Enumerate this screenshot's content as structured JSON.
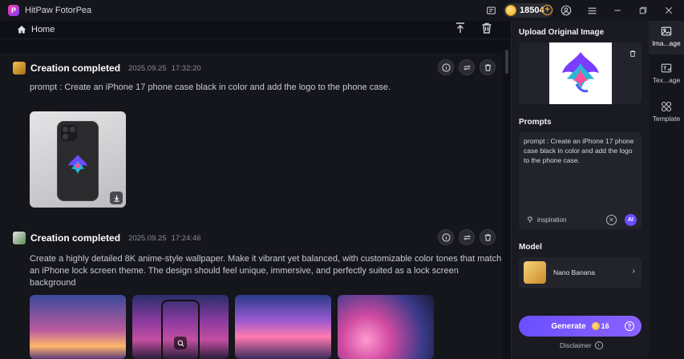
{
  "app": {
    "title": "HitPaw FotorPea",
    "logo_letter": "P"
  },
  "titlebar": {
    "coins": "18504"
  },
  "toolbar": {
    "home_label": "Home"
  },
  "feed": {
    "cards": [
      {
        "title": "Creation completed",
        "date": "2025.09.25",
        "time": "17:32:20",
        "prompt": "prompt : Create an iPhone 17 phone case black in color and add the logo to the phone case."
      },
      {
        "title": "Creation completed",
        "date": "2025.09.25",
        "time": "17:24:46",
        "prompt_line1": "Create a highly detailed 8K anime-style wallpaper.  Make it vibrant yet balanced, with customizable color tones that match",
        "prompt_line2": "an iPhone lock screen theme. The design should feel unique, immersive, and perfectly suited as a lock screen background"
      }
    ]
  },
  "panel": {
    "upload_label": "Upload Original Image",
    "prompts_label": "Prompts",
    "prompt_text": "prompt : Create an iPhone 17 phone case black in color and add the logo to the phone case.",
    "inspiration": "inspiration",
    "ai_label": "AI",
    "model_label": "Model",
    "model_name": "Nano Banana",
    "generate_label": "Generate",
    "generate_cost": "16",
    "disclaimer": "Disclaimer"
  },
  "sidebar": {
    "items": [
      {
        "label": "Ima...age"
      },
      {
        "label": "Tex...age"
      },
      {
        "label": "Template"
      }
    ]
  }
}
